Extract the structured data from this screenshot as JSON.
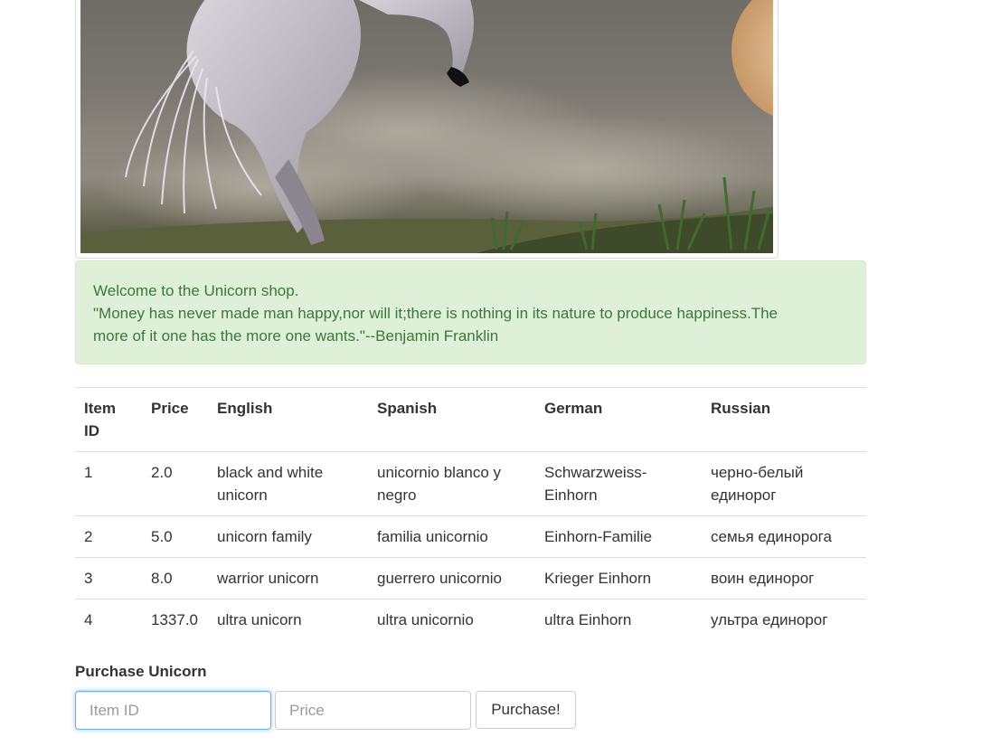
{
  "hero": {
    "image_alt": "unicorn rearing in front of a moon",
    "icon": "unicorn-image"
  },
  "alert": {
    "welcome": "Welcome to the Unicorn shop.",
    "quote": "\"Money has never made man happy,nor will it;there is nothing in its nature to produce happiness.The more of it one has the more one wants.\"--Benjamin Franklin",
    "colors": {
      "background": "#dff0d8",
      "text": "#3c763d"
    }
  },
  "table": {
    "headers": [
      "Item ID",
      "Price",
      "English",
      "Spanish",
      "German",
      "Russian"
    ],
    "rows": [
      [
        "1",
        "2.0",
        "black and white unicorn",
        "unicornio blanco y negro",
        "Schwarzweiss-Einhorn",
        "черно-белый единорог"
      ],
      [
        "2",
        "5.0",
        "unicorn family",
        "familia unicornio",
        "Einhorn-Familie",
        "семья единорога"
      ],
      [
        "3",
        "8.0",
        "warrior unicorn",
        "guerrero unicornio",
        "Krieger Einhorn",
        "воин единорог"
      ],
      [
        "4",
        "1337.0",
        "ultra unicorn",
        "ultra unicornio",
        "ultra Einhorn",
        "ультра единорог"
      ]
    ]
  },
  "purchase": {
    "title": "Purchase Unicorn",
    "item_id": {
      "value": "",
      "placeholder": "Item ID"
    },
    "price": {
      "value": "",
      "placeholder": "Price"
    },
    "button_label": "Purchase!"
  }
}
